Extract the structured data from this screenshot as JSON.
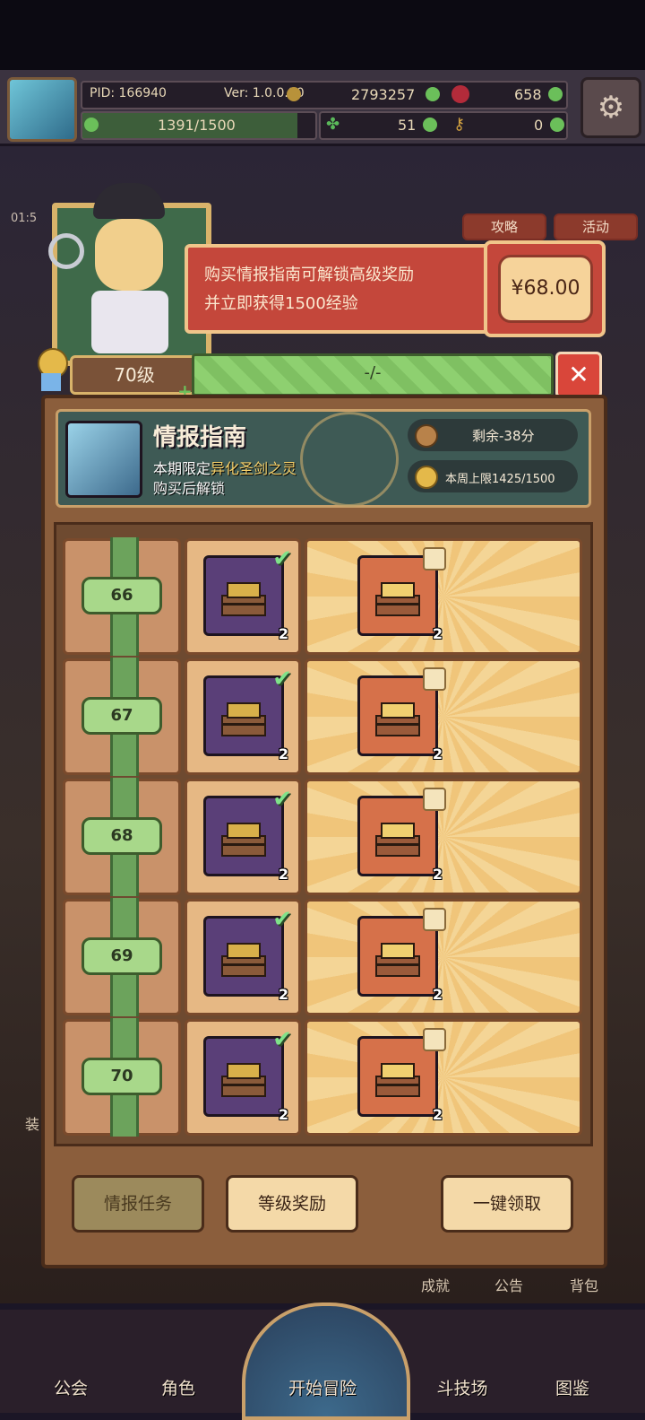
{
  "hud": {
    "pid": "PID: 166940",
    "version": "Ver: 1.0.0.10",
    "coins": "2793257",
    "gems": "658",
    "exp": "1391/1500",
    "clover": "51",
    "keys": "0"
  },
  "side_tabs": {
    "strategy": "攻略",
    "event": "活动"
  },
  "time_fragment": "01:5",
  "promo": {
    "text_line1": "购买情报指南可解锁高级奖励",
    "text_line2": "并立即获得1500经验",
    "price": "¥68.00"
  },
  "level_bar": {
    "level": "70级",
    "progress_text": "-/-"
  },
  "guide": {
    "title": "情报指南",
    "subtitle_prefix": "本期限定",
    "subtitle_highlight": "异化圣剑之灵",
    "unlock_text": "购买后解锁",
    "remaining": "剩余-38分",
    "weekly_cap": "本周上限1425/1500"
  },
  "rows": [
    {
      "level": "66",
      "free_qty": "2",
      "paid_qty": "2"
    },
    {
      "level": "67",
      "free_qty": "2",
      "paid_qty": "2"
    },
    {
      "level": "68",
      "free_qty": "2",
      "paid_qty": "2"
    },
    {
      "level": "69",
      "free_qty": "2",
      "paid_qty": "2"
    },
    {
      "level": "70",
      "free_qty": "2",
      "paid_qty": "2"
    }
  ],
  "buttons": {
    "intel_tasks": "情报任务",
    "level_rewards": "等级奖励",
    "claim_all": "一键领取"
  },
  "side_labels": {
    "achievement": "成就",
    "notice": "公告",
    "bag": "背包",
    "equip": "装"
  },
  "nav": [
    "公会",
    "角色",
    "开始冒险",
    "斗技场",
    "图鉴"
  ]
}
